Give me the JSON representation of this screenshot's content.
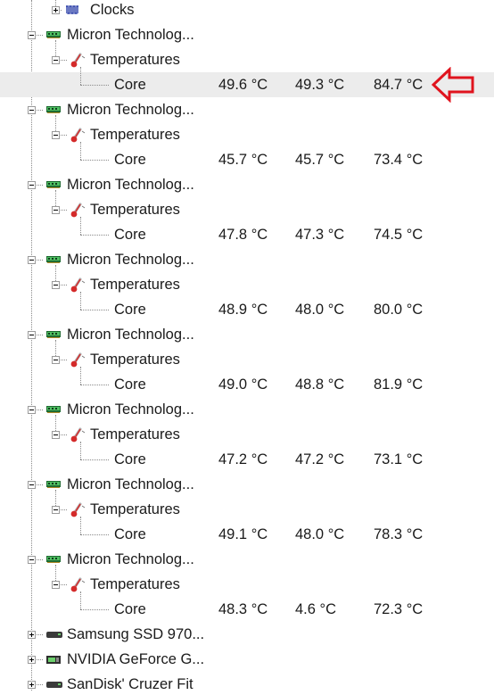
{
  "tree": {
    "clocks_label": "Clocks",
    "devices": [
      {
        "name": "Micron Technolog...",
        "group": "Temperatures",
        "sensor": "Core",
        "value": "49.6 °C",
        "min": "49.3 °C",
        "max": "84.7 °C",
        "highlighted": true
      },
      {
        "name": "Micron Technolog...",
        "group": "Temperatures",
        "sensor": "Core",
        "value": "45.7 °C",
        "min": "45.7 °C",
        "max": "73.4 °C"
      },
      {
        "name": "Micron Technolog...",
        "group": "Temperatures",
        "sensor": "Core",
        "value": "47.8 °C",
        "min": "47.3 °C",
        "max": "74.5 °C"
      },
      {
        "name": "Micron Technolog...",
        "group": "Temperatures",
        "sensor": "Core",
        "value": "48.9 °C",
        "min": "48.0 °C",
        "max": "80.0 °C"
      },
      {
        "name": "Micron Technolog...",
        "group": "Temperatures",
        "sensor": "Core",
        "value": "49.0 °C",
        "min": "48.8 °C",
        "max": "81.9 °C"
      },
      {
        "name": "Micron Technolog...",
        "group": "Temperatures",
        "sensor": "Core",
        "value": "47.2 °C",
        "min": "47.2 °C",
        "max": "73.1 °C"
      },
      {
        "name": "Micron Technolog...",
        "group": "Temperatures",
        "sensor": "Core",
        "value": "49.1 °C",
        "min": "48.0 °C",
        "max": "78.3 °C"
      },
      {
        "name": "Micron Technolog...",
        "group": "Temperatures",
        "sensor": "Core",
        "value": "48.3 °C",
        "min": "4.6 °C",
        "max": "72.3 °C"
      }
    ],
    "collapsed_devices": [
      {
        "name": "Samsung SSD 970...",
        "icon": "drive-icon"
      },
      {
        "name": "NVIDIA GeForce G...",
        "icon": "gpu-card-icon"
      },
      {
        "name": "SanDisk' Cruzer Fit",
        "icon": "drive-icon"
      }
    ]
  },
  "annotation": {
    "icon": "arrow-left-icon",
    "color": "#e0141e"
  },
  "colors": {
    "highlight_row": "#ececec",
    "tree_lines": "#8a8a8a"
  }
}
